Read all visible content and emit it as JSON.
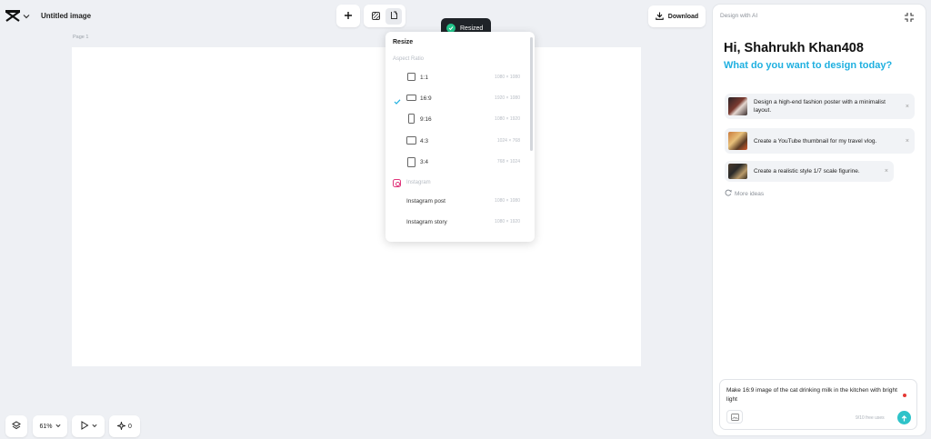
{
  "header": {
    "doc_title": "Untitled image",
    "download_label": "Download",
    "toast_text": "Resized"
  },
  "canvas": {
    "page_label": "Page 1"
  },
  "resize_menu": {
    "title": "Resize",
    "section_aspect": "Aspect Ratio",
    "aspect_items": [
      {
        "label": "1:1",
        "dim": "1080 × 1080",
        "selected": false
      },
      {
        "label": "16:9",
        "dim": "1920 × 1080",
        "selected": true
      },
      {
        "label": "9:16",
        "dim": "1080 × 1920",
        "selected": false
      },
      {
        "label": "4:3",
        "dim": "1024 × 768",
        "selected": false
      },
      {
        "label": "3:4",
        "dim": "768 × 1024",
        "selected": false
      }
    ],
    "section_instagram": "Instagram",
    "instagram_items": [
      {
        "label": "Instagram post",
        "dim": "1080 × 1080"
      },
      {
        "label": "Instagram story",
        "dim": "1080 × 1920"
      }
    ]
  },
  "ai_panel": {
    "label": "Design with AI",
    "greeting": "Hi, Shahrukh Khan408",
    "subtitle": "What do you want to design today?",
    "suggestions": [
      {
        "text": "Design a high-end fashion poster with a minimalist layout."
      },
      {
        "text": "Create a YouTube thumbnail for my travel vlog."
      },
      {
        "text": "Create a realistic style 1/7 scale figurine."
      }
    ],
    "more_ideas": "More ideas",
    "prompt_text": "Make 16:9 image of the cat drinking milk in the kitchen with bright light",
    "free_uses": "9/10 free uses"
  },
  "bottom_bar": {
    "zoom": "61%",
    "credits": "0"
  },
  "colors": {
    "accent": "#1fb0e0",
    "send": "#2ec3c9",
    "toast_bg": "#1f2328",
    "toast_check": "#22c58b",
    "selected_check": "#1fb0e0"
  }
}
